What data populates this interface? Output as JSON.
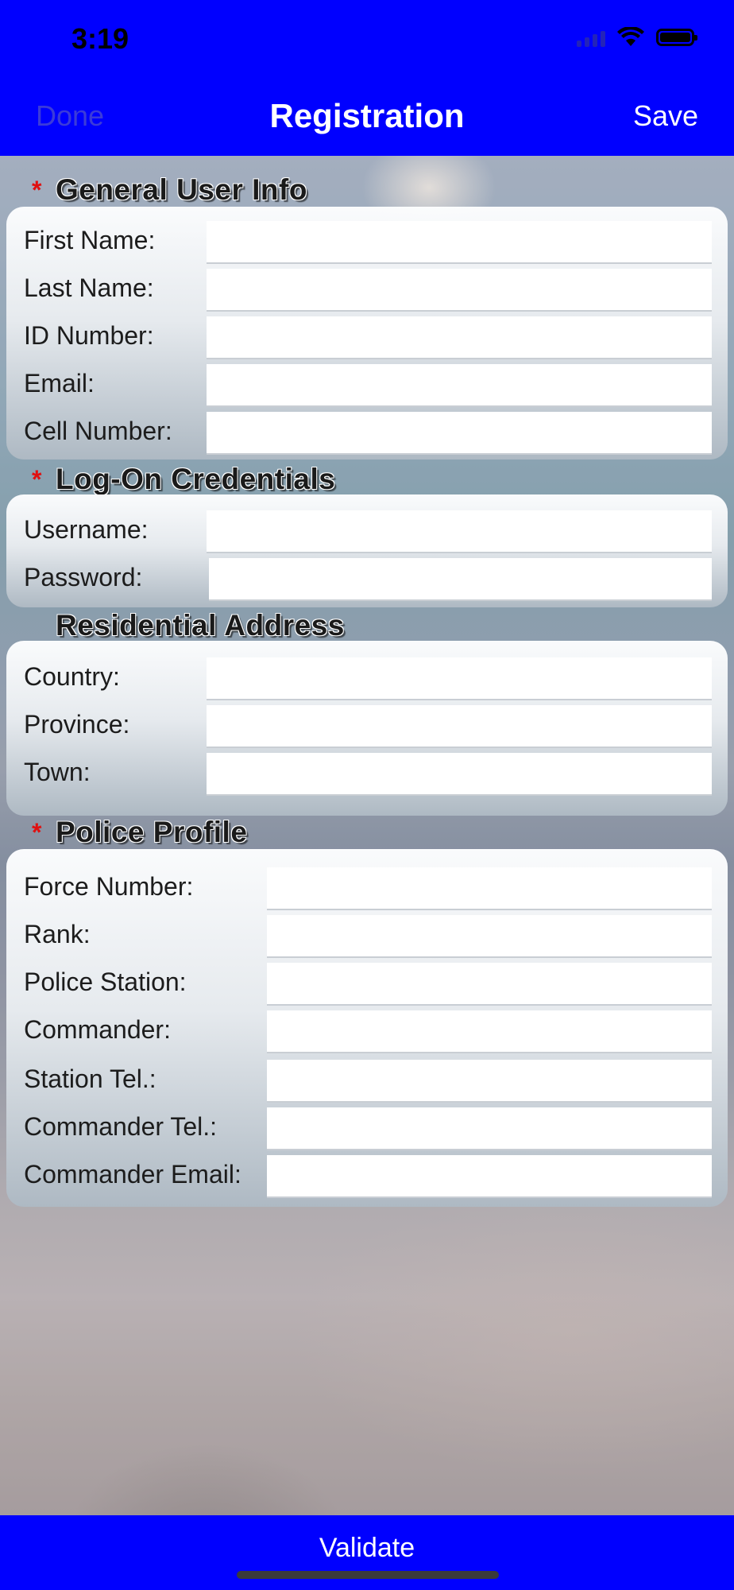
{
  "status_bar": {
    "time": "3:19"
  },
  "nav": {
    "done_label": "Done",
    "title": "Registration",
    "save_label": "Save"
  },
  "sections": {
    "general": {
      "required_marker": "*",
      "title": "General User Info",
      "fields": [
        {
          "label": "First Name:",
          "value": ""
        },
        {
          "label": "Last Name:",
          "value": ""
        },
        {
          "label": "ID Number:",
          "value": ""
        },
        {
          "label": "Email:",
          "value": ""
        },
        {
          "label": "Cell Number:",
          "value": ""
        }
      ]
    },
    "logon": {
      "required_marker": "*",
      "title": "Log-On Credentials",
      "fields": [
        {
          "label": "Username:",
          "value": ""
        },
        {
          "label": "Password:",
          "value": ""
        }
      ]
    },
    "address": {
      "title": "Residential Address",
      "fields": [
        {
          "label": "Country:",
          "value": ""
        },
        {
          "label": "Province:",
          "value": ""
        },
        {
          "label": "Town:",
          "value": ""
        }
      ]
    },
    "police": {
      "required_marker": "*",
      "title": "Police Profile",
      "fields": [
        {
          "label": "Force Number:",
          "value": ""
        },
        {
          "label": "Rank:",
          "value": ""
        },
        {
          "label": "Police Station:",
          "value": ""
        },
        {
          "label": "Commander:",
          "value": ""
        },
        {
          "label": "Station Tel.:",
          "value": ""
        },
        {
          "label": "Commander Tel.:",
          "value": ""
        },
        {
          "label": "Commander Email:",
          "value": ""
        }
      ]
    }
  },
  "bottom": {
    "validate_label": "Validate"
  },
  "colors": {
    "bar_blue": "#0000ff",
    "required_red": "#e01010",
    "done_disabled": "#3b3bd9"
  }
}
